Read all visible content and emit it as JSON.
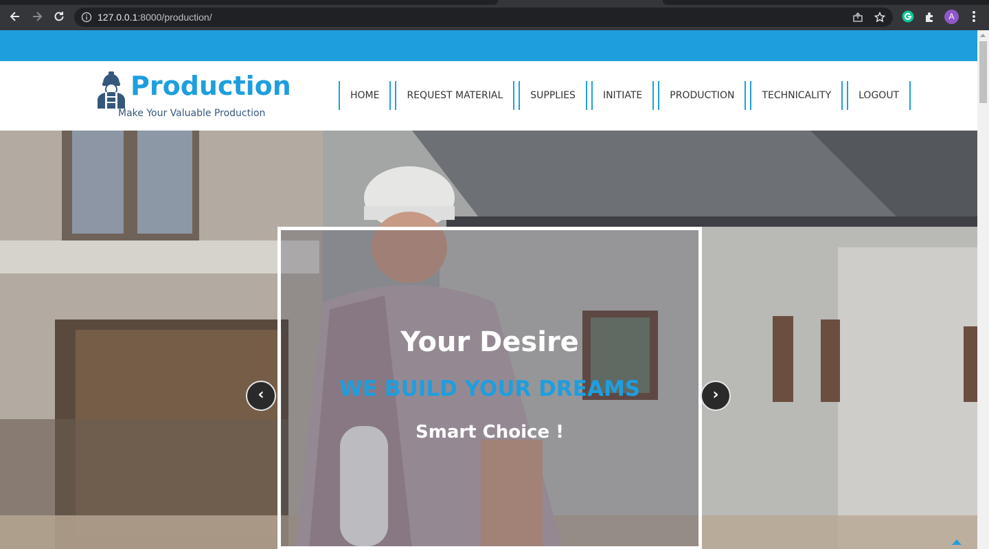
{
  "browser": {
    "url_host": "127.0.0.1",
    "url_rest": ":8000/production/",
    "avatar_letter": "A",
    "accent": "#1f9ede"
  },
  "brand": {
    "title": "Production",
    "tagline": "Make Your Valuable Production",
    "icon": "worker-icon"
  },
  "menu": {
    "items": [
      "HOME",
      "REQUEST MATERIAL",
      "SUPPLIES",
      "INITIATE",
      "PRODUCTION",
      "TECHNICALITY",
      "LOGOUT"
    ]
  },
  "hero": {
    "title": "Your Desire",
    "subtitle": "WE BUILD YOUR DREAMS",
    "note": "Smart Choice !",
    "prev_icon": "‹",
    "next_icon": "›"
  },
  "colors": {
    "topbar": "#1f9ede",
    "brand_title": "#1f9ede",
    "brand_tag": "#36577c"
  }
}
